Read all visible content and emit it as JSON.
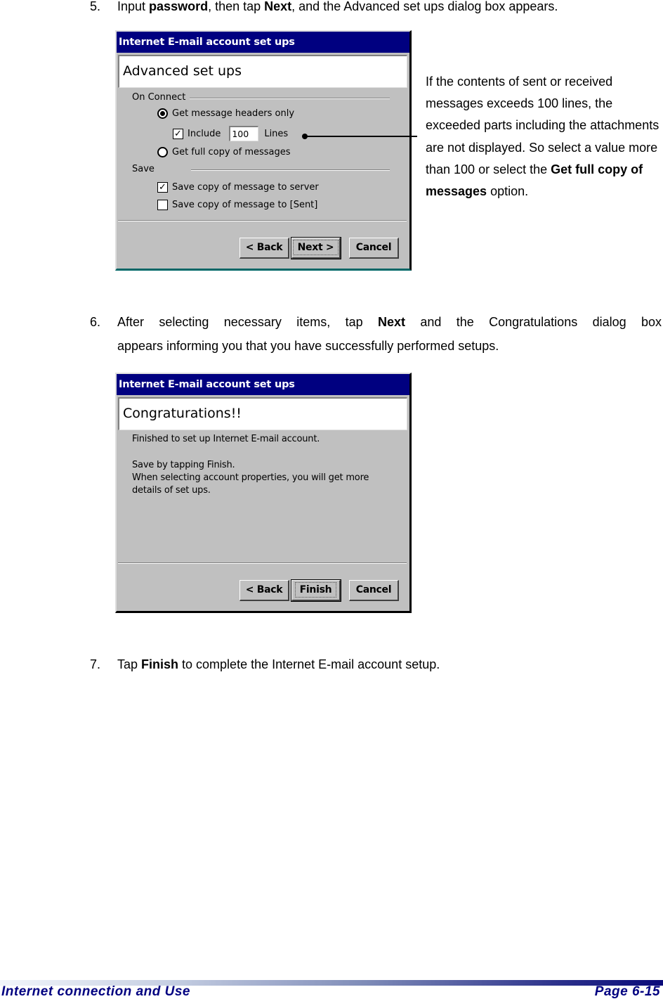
{
  "steps": {
    "s5": {
      "num": "5.",
      "pre": "Input ",
      "b1": "password",
      "mid": ", then tap ",
      "b2": "Next",
      "post": ", and the Advanced set ups dialog box appears."
    },
    "s6": {
      "num": "6.",
      "pre": "After selecting necessary items, tap ",
      "b1": "Next",
      "post": " and the Congratulations dialog box",
      "line2": "appears informing you that you have successfully performed setups."
    },
    "s7": {
      "num": "7.",
      "pre": "Tap ",
      "b1": "Finish",
      "post": " to complete the Internet E-mail account setup."
    }
  },
  "dialog_advanced": {
    "title": "Internet E-mail account set ups",
    "header": "Advanced set ups",
    "on_connect_label": "On Connect",
    "radio_headers": {
      "label": "Get message headers only",
      "selected": true
    },
    "include_check": {
      "label": "Include",
      "checked": true
    },
    "lines_value": "100",
    "lines_label": "Lines",
    "radio_full": {
      "label": "Get full copy of messages",
      "selected": false
    },
    "save_label": "Save",
    "check_server": {
      "label": "Save copy of message to server",
      "checked": true
    },
    "check_sent": {
      "label": "Save copy of message to [Sent]",
      "checked": false
    },
    "buttons": {
      "back": "< Back",
      "next": "Next >",
      "cancel": "Cancel"
    }
  },
  "dialog_congrats": {
    "title": "Internet E-mail account set ups",
    "header": "Congraturations!!",
    "line1": "Finished to set up Internet E-mail account.",
    "line2": "Save by tapping Finish.\nWhen selecting account properties, you will get more\ndetails of set ups.",
    "buttons": {
      "back": "< Back",
      "finish": "Finish",
      "cancel": "Cancel"
    }
  },
  "callout": {
    "text1": "If the contents of sent or received messages exceeds 100 lines, the exceeded parts including the attachments are not displayed. So select a value more than 100 or select the ",
    "bold": "Get full copy of messages",
    "text2": " option."
  },
  "footer": {
    "section": "Internet connection and Use",
    "page": "Page 6-15",
    "accent": "#000080"
  }
}
